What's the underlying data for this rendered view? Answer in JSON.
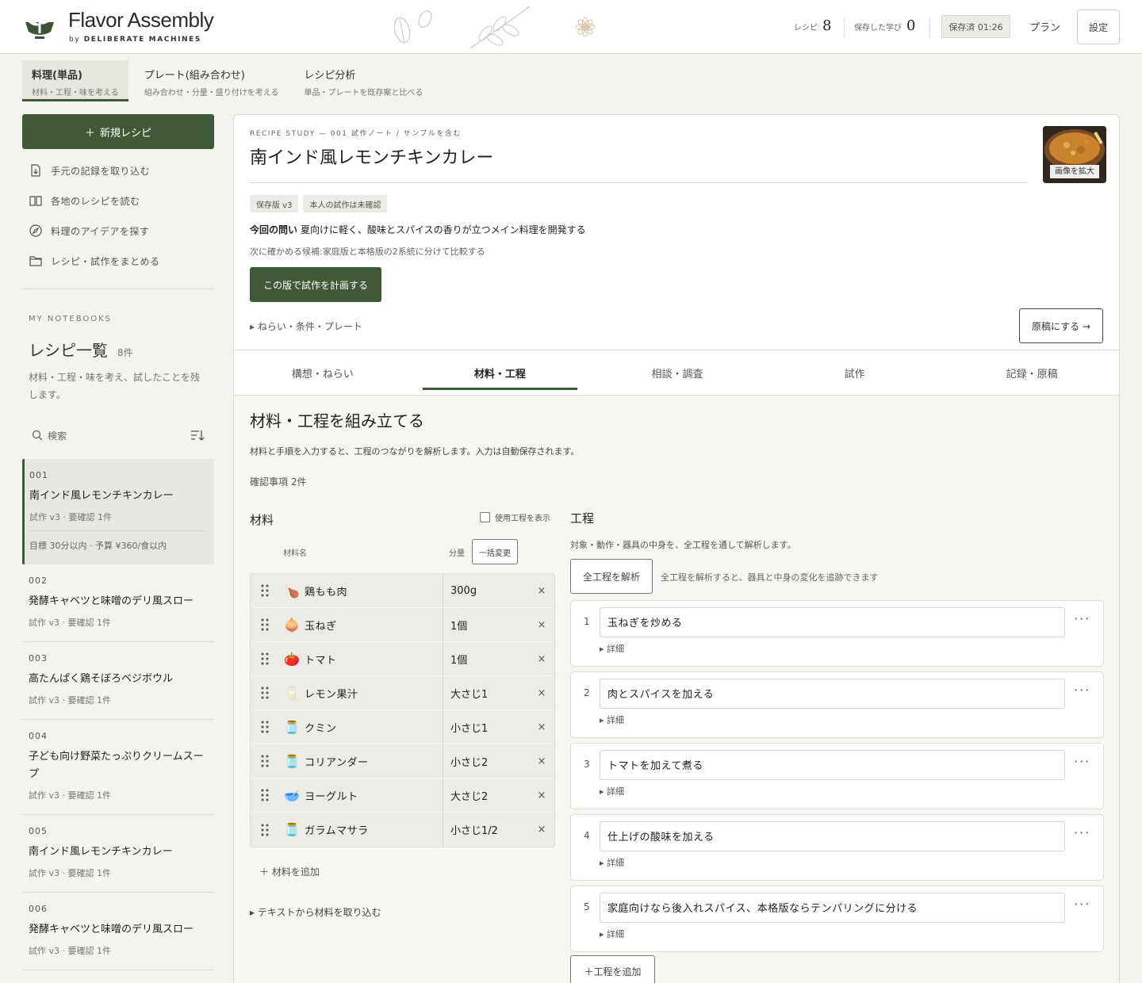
{
  "brand": {
    "name": "Flavor Assembly",
    "by": "by",
    "company": "DELIBERATE MACHINES"
  },
  "header": {
    "recipes_label": "レシピ",
    "recipes_count": "8",
    "learnings_label": "保存した学び",
    "learnings_count": "0",
    "saved_status": "保存済 01:26",
    "plan_label": "プラン",
    "settings_label": "設定"
  },
  "mode_tabs": [
    {
      "title": "料理(単品)",
      "sub": "材料・工程・味を考える"
    },
    {
      "title": "プレート(組み合わせ)",
      "sub": "組み合わせ・分量・盛り付けを考える"
    },
    {
      "title": "レシピ分析",
      "sub": "単品・プレートを既存案と比べる"
    }
  ],
  "sidebar": {
    "new_recipe": "新規レシピ",
    "nav": [
      {
        "label": "手元の記録を取り込む",
        "icon": "file-import-icon"
      },
      {
        "label": "各地のレシピを読む",
        "icon": "book-open-icon"
      },
      {
        "label": "料理のアイデアを探す",
        "icon": "compass-icon"
      },
      {
        "label": "レシピ・試作をまとめる",
        "icon": "folder-icon"
      }
    ],
    "notebooks_label": "MY NOTEBOOKS",
    "list_title": "レシピ一覧",
    "list_count": "8件",
    "list_desc": "材料・工程・味を考え、試したことを残します。",
    "search_label": "検索"
  },
  "recipes": [
    {
      "num": "001",
      "name": "南インド風レモンチキンカレー",
      "meta": "試作 v3 · 要確認 1件",
      "goal": "目標 30分以内 · 予算 ¥360/食以内"
    },
    {
      "num": "002",
      "name": "発酵キャベツと味噌のデリ風スロー",
      "meta": "試作 v3 · 要確認 1件"
    },
    {
      "num": "003",
      "name": "高たんぱく鶏そぼろベジボウル",
      "meta": "試作 v3 · 要確認 1件"
    },
    {
      "num": "004",
      "name": "子ども向け野菜たっぷりクリームスープ",
      "meta": "試作 v3 · 要確認 1件"
    },
    {
      "num": "005",
      "name": "南インド風レモンチキンカレー",
      "meta": "試作 v3 · 要確認 1件"
    },
    {
      "num": "006",
      "name": "発酵キャベツと味噌のデリ風スロー",
      "meta": "試作 v3 · 要確認 1件"
    }
  ],
  "study": {
    "kicker": "RECIPE STUDY — 001 試作ノート / サンプルを含む",
    "title": "南インド風レモンチキンカレー",
    "image_label": "画像を拡大",
    "badges": [
      "保存版 v3",
      "本人の試作は未確認"
    ],
    "question_label": "今回の問い",
    "question": "夏向けに軽く、酸味とスパイスの香りが立つメイン料理を開発する",
    "candidate": "次に確かめる候補:家庭版と本格版の2系統に分けて比較する",
    "plan_button": "この版で試作を計画する",
    "aim_toggle": "ねらい・条件・プレート",
    "draft_button": "原稿にする →"
  },
  "stage_tabs": [
    "構想・ねらい",
    "材料・工程",
    "相談・調査",
    "試作",
    "記録・原稿"
  ],
  "assemble": {
    "title": "材料・工程を組み立てる",
    "desc": "材料と手順を入力すると、工程のつながりを解析します。入力は自動保存されます。",
    "confirm": "確認事項 2件",
    "ingredients_title": "材料",
    "show_process": "使用工程を表示",
    "col_name": "材料名",
    "col_qty": "分量",
    "bulk_change": "一括変更",
    "ingredients": [
      {
        "name": "鶏もも肉",
        "qty": "300g",
        "icon": "🍗"
      },
      {
        "name": "玉ねぎ",
        "qty": "1個",
        "icon": "🧅"
      },
      {
        "name": "トマト",
        "qty": "1個",
        "icon": "🍅"
      },
      {
        "name": "レモン果汁",
        "qty": "大さじ1",
        "icon": "🥛"
      },
      {
        "name": "クミン",
        "qty": "小さじ1",
        "icon": "🫙"
      },
      {
        "name": "コリアンダー",
        "qty": "小さじ2",
        "icon": "🫙"
      },
      {
        "name": "ヨーグルト",
        "qty": "大さじ2",
        "icon": "🥣"
      },
      {
        "name": "ガラムマサラ",
        "qty": "小さじ1/2",
        "icon": "🫙"
      }
    ],
    "add_ingredient": "材料を追加",
    "text_import": "テキストから材料を取り込む",
    "process_title": "工程",
    "process_desc": "対象・動作・器具の中身を、全工程を通して解析します。",
    "analyze_all": "全工程を解析",
    "analyze_hint": "全工程を解析すると、器具と中身の変化を追跡できます",
    "detail_label": "詳細",
    "steps": [
      {
        "n": "1",
        "text": "玉ねぎを炒める"
      },
      {
        "n": "2",
        "text": "肉とスパイスを加える"
      },
      {
        "n": "3",
        "text": "トマトを加えて煮る"
      },
      {
        "n": "4",
        "text": "仕上げの酸味を加える"
      },
      {
        "n": "5",
        "text": "家庭向けなら後入れスパイス、本格版ならテンパリングに分ける"
      }
    ],
    "add_step": "工程を追加"
  }
}
